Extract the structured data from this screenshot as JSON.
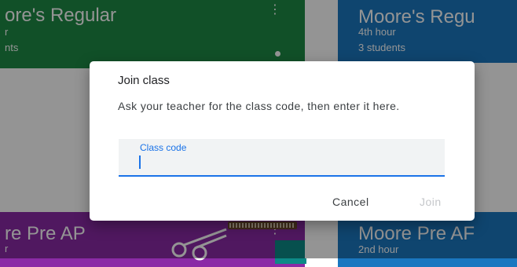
{
  "classes": [
    {
      "title": "ore's Regular",
      "line1": "r",
      "line2": "nts"
    },
    {
      "title": "Moore's Regu",
      "line1": "4th hour",
      "line2": "3 students"
    },
    {
      "title": "re Pre AP",
      "line1": "r"
    },
    {
      "title": "Moore Pre AF",
      "line1": "2nd hour"
    }
  ],
  "dialog": {
    "title": "Join class",
    "message": "Ask your teacher for the class code, then enter it here.",
    "field_label": "Class code",
    "field_value": "",
    "cancel_label": "Cancel",
    "join_label": "Join"
  },
  "colors": {
    "green_card": "#1e8a46",
    "blue_card": "#1a77c0",
    "purple_card": "#8b2aa6",
    "accent": "#1a73e8",
    "disabled": "#c5c7ca"
  },
  "icons": {
    "card_menu": "more-vert-icon",
    "decor": "scissors-icon"
  }
}
